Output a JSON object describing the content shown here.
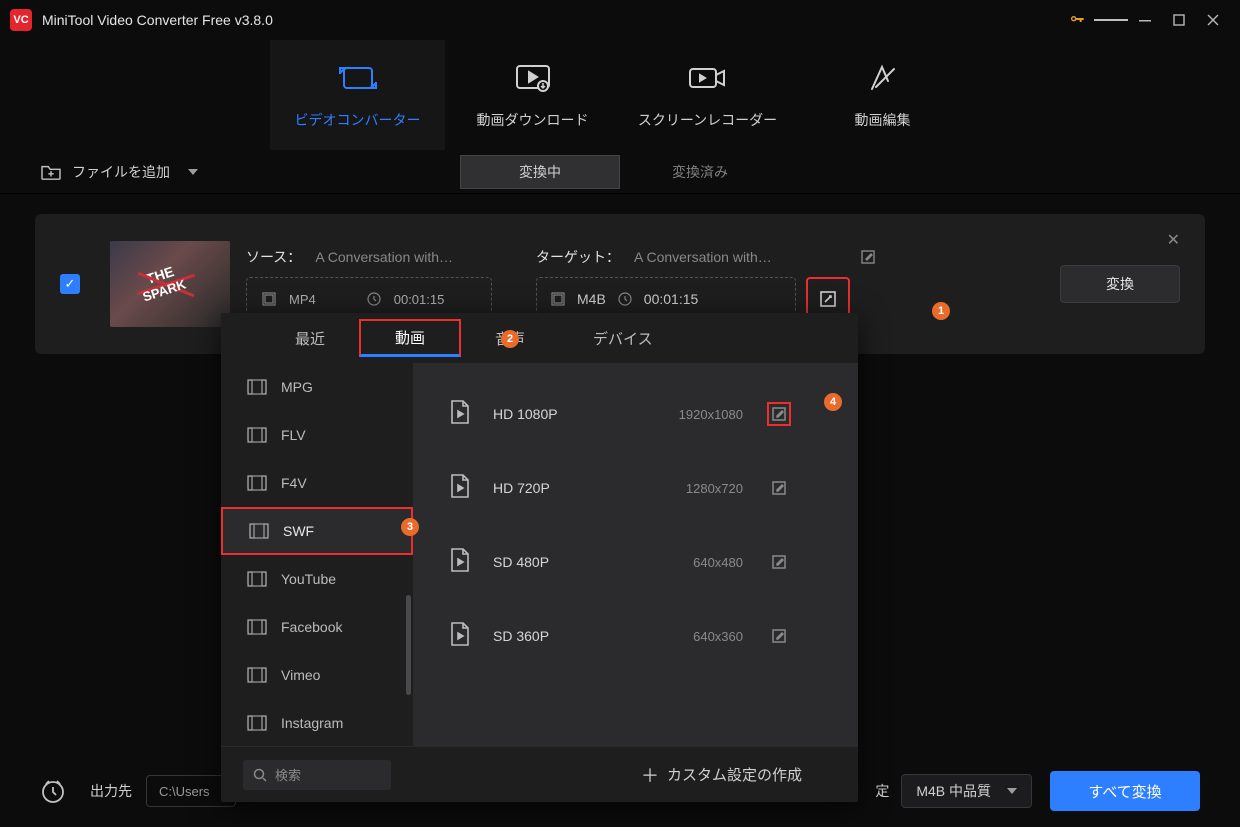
{
  "app": {
    "title": "MiniTool Video Converter Free v3.8.0"
  },
  "mainTabs": {
    "converter": "ビデオコンバーター",
    "download": "動画ダウンロード",
    "recorder": "スクリーンレコーダー",
    "editor": "動画編集"
  },
  "toolbar": {
    "addFile": "ファイルを追加",
    "converting": "変換中",
    "converted": "変換済み"
  },
  "item": {
    "sourceLabel": "ソース：",
    "sourceName": "A Conversation with…",
    "sourceFmt": "MP4",
    "sourceDur": "00:01:15",
    "targetLabel": "ターゲット：",
    "targetName": "A Conversation with…",
    "targetFmt": "M4B",
    "targetDur": "00:01:15",
    "convert": "変換"
  },
  "popup": {
    "tabs": {
      "recent": "最近",
      "video": "動画",
      "audio": "音声",
      "device": "デバイス"
    },
    "formats": [
      "MPG",
      "FLV",
      "F4V",
      "SWF",
      "YouTube",
      "Facebook",
      "Vimeo",
      "Instagram"
    ],
    "selectedFormat": "SWF",
    "presets": [
      {
        "name": "HD 1080P",
        "res": "1920x1080"
      },
      {
        "name": "HD 720P",
        "res": "1280x720"
      },
      {
        "name": "SD 480P",
        "res": "640x480"
      },
      {
        "name": "SD 360P",
        "res": "640x360"
      }
    ],
    "searchPlaceholder": "検索",
    "customCreate": "カスタム設定の作成"
  },
  "bottom": {
    "outputLabel": "出力先",
    "outputPath": "C:\\Users",
    "trailingLabel": "定",
    "quality": "M4B 中品質",
    "convertAll": "すべて変換"
  },
  "badges": {
    "b1": "1",
    "b2": "2",
    "b3": "3",
    "b4": "4"
  }
}
